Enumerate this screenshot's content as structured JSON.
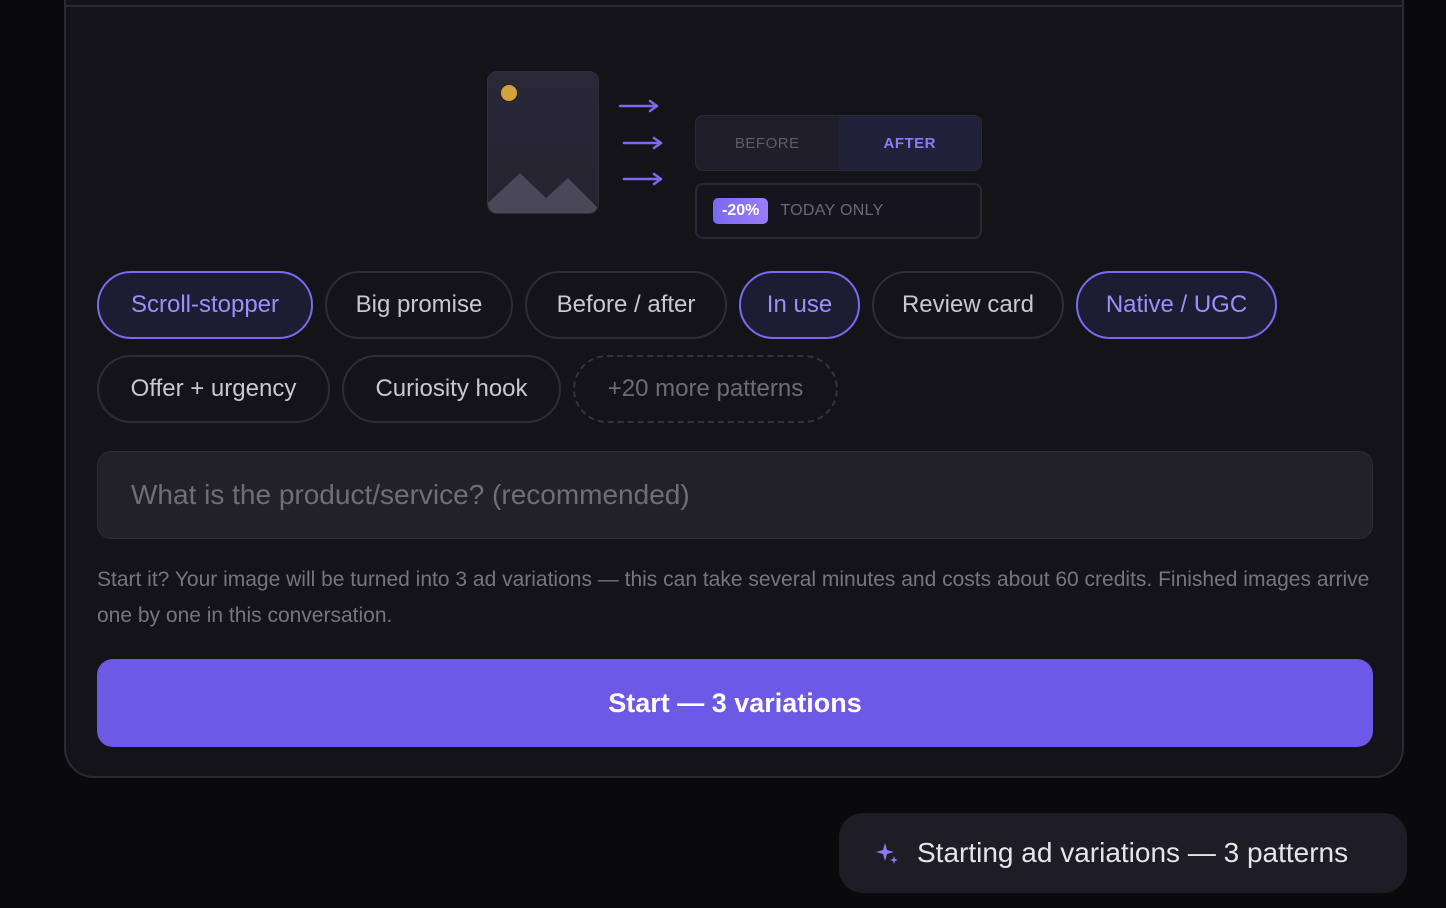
{
  "illustration": {
    "before_label": "BEFORE",
    "after_label": "AFTER",
    "discount_badge": "-20%",
    "offer_label": "TODAY ONLY"
  },
  "patterns": [
    {
      "label": "Scroll-stopper",
      "selected": true
    },
    {
      "label": "Big promise",
      "selected": false
    },
    {
      "label": "Before / after",
      "selected": false
    },
    {
      "label": "In use",
      "selected": true
    },
    {
      "label": "Review card",
      "selected": false
    },
    {
      "label": "Native / UGC",
      "selected": true
    },
    {
      "label": "Offer + urgency",
      "selected": false
    },
    {
      "label": "Curiosity hook",
      "selected": false
    }
  ],
  "more_patterns_label": "+20 more patterns",
  "product_input": {
    "value": "",
    "placeholder": "What is the product/service? (recommended)"
  },
  "notice": "Start it? Your image will be turned into 3 ad variations — this can take several minutes and costs about 60 credits. Finished images arrive one by one in this conversation.",
  "start_button_label": "Start — 3 variations",
  "status": {
    "icon": "sparkle-icon",
    "text": "Starting ad variations — 3 patterns"
  },
  "colors": {
    "accent": "#6c5ae6",
    "accent_light": "#9d8ff7",
    "background": "#0a0a0d",
    "card": "#141418",
    "sun": "#d4a23a"
  }
}
